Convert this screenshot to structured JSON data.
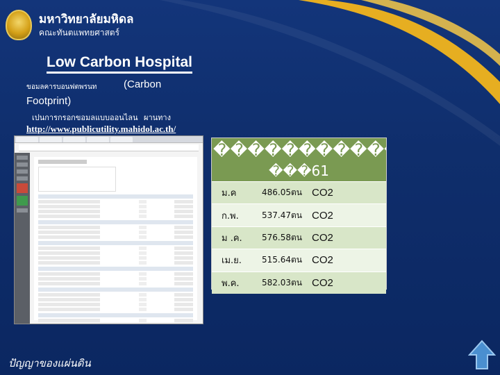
{
  "header": {
    "university": "มหาวิทยาลัยมหิดล",
    "faculty": "คณะทันตแพทยศาสตร์"
  },
  "slide": {
    "title": "Low Carbon Hospital",
    "para1_thai": "ขอมลคารบอนฟตพรนท",
    "para1_en": "(Carbon",
    "para2": "Footprint)",
    "para3_thai": "เปนการกรอกขอมลแบบออนไลน",
    "para3_thai2": "ผานทาง",
    "url": "http://www.publicutility.mahidol.ac.th/"
  },
  "table": {
    "header_line1": "������������������",
    "header_line2": "���61",
    "rows": [
      {
        "month": "ม.ค",
        "value": "486.05ตน",
        "unit": "CO2"
      },
      {
        "month": "ก.พ.",
        "value": "537.47ตน",
        "unit": "CO2"
      },
      {
        "month": "ม .ค.",
        "value": "576.58ตน",
        "unit": "CO2"
      },
      {
        "month": "เม.ย.",
        "value": "515.64ตน",
        "unit": "CO2"
      },
      {
        "month": "พ.ค.",
        "value": "582.03ตน",
        "unit": "CO2"
      }
    ]
  },
  "footer": {
    "signature": "ปัญญาของแผ่นดิน"
  },
  "colors": {
    "background": "#0e2f6e",
    "gold": "#f2b51c",
    "table_header": "#7a9a52",
    "nav_arrow": "#4a8fd0"
  },
  "icons": {
    "logo": "university-seal-icon",
    "nav": "arrow-up-icon"
  }
}
